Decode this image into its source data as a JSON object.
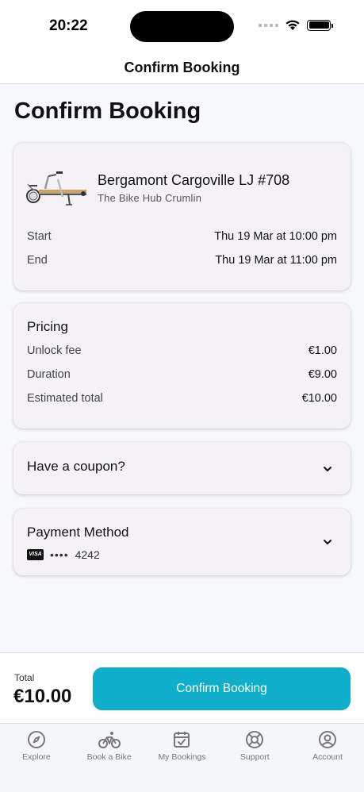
{
  "status_bar": {
    "time": "20:22"
  },
  "nav": {
    "title": "Confirm Booking"
  },
  "page": {
    "title": "Confirm Booking"
  },
  "bike_card": {
    "name": "Bergamont Cargoville LJ #708",
    "location": "The Bike Hub Crumlin",
    "start_label": "Start",
    "start_value": "Thu 19 Mar at 10:00 pm",
    "end_label": "End",
    "end_value": "Thu 19 Mar at 11:00 pm"
  },
  "pricing": {
    "title": "Pricing",
    "rows": [
      {
        "label": "Unlock fee",
        "value": "€1.00"
      },
      {
        "label": "Duration",
        "value": "€9.00"
      },
      {
        "label": "Estimated total",
        "value": "€10.00"
      }
    ]
  },
  "coupon": {
    "title": "Have a coupon?"
  },
  "payment": {
    "title": "Payment Method",
    "card_brand": "VISA",
    "masked": "••••",
    "last4": "4242"
  },
  "footer": {
    "total_label": "Total",
    "total_value": "€10.00",
    "confirm_label": "Confirm Booking"
  },
  "tabs": [
    {
      "label": "Explore",
      "icon": "compass-icon"
    },
    {
      "label": "Book a Bike",
      "icon": "bike-icon"
    },
    {
      "label": "My Bookings",
      "icon": "calendar-check-icon"
    },
    {
      "label": "Support",
      "icon": "lifebuoy-icon"
    },
    {
      "label": "Account",
      "icon": "user-circle-icon"
    }
  ],
  "colors": {
    "accent": "#0faecb",
    "card_bg": "#f4f2f7",
    "page_bg": "#f7f8fb"
  }
}
